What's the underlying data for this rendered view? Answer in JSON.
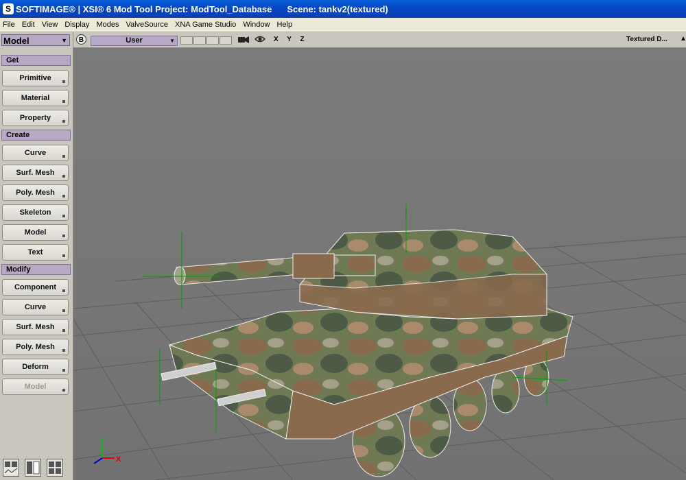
{
  "window": {
    "title": "SOFTIMAGE® | XSI® 6 Mod Tool Project: ModTool_Database",
    "scene": "Scene: tankv2(textured)"
  },
  "menu": [
    "File",
    "Edit",
    "View",
    "Display",
    "Modes",
    "ValveSource",
    "XNA Game Studio",
    "Window",
    "Help"
  ],
  "left_panel": {
    "mode": "Model",
    "sections": [
      {
        "header": "Get",
        "buttons": [
          "Primitive",
          "Material",
          "Property"
        ]
      },
      {
        "header": "Create",
        "buttons": [
          "Curve",
          "Surf. Mesh",
          "Poly. Mesh",
          "Skeleton",
          "Model",
          "Text"
        ]
      },
      {
        "header": "Modify",
        "buttons": [
          "Component",
          "Curve",
          "Surf. Mesh",
          "Poly. Mesh",
          "Deform",
          "Model"
        ]
      }
    ]
  },
  "viewport": {
    "camera_letter": "B",
    "view": "User",
    "axes": "X Y Z",
    "display_mode": "Textured D...",
    "gizmo": {
      "y": "Y",
      "x": "X"
    }
  },
  "colors": {
    "title_bar": "#0646c4",
    "section_header": "#b7a9c6",
    "viewport_bg": "#7a7a7a"
  }
}
